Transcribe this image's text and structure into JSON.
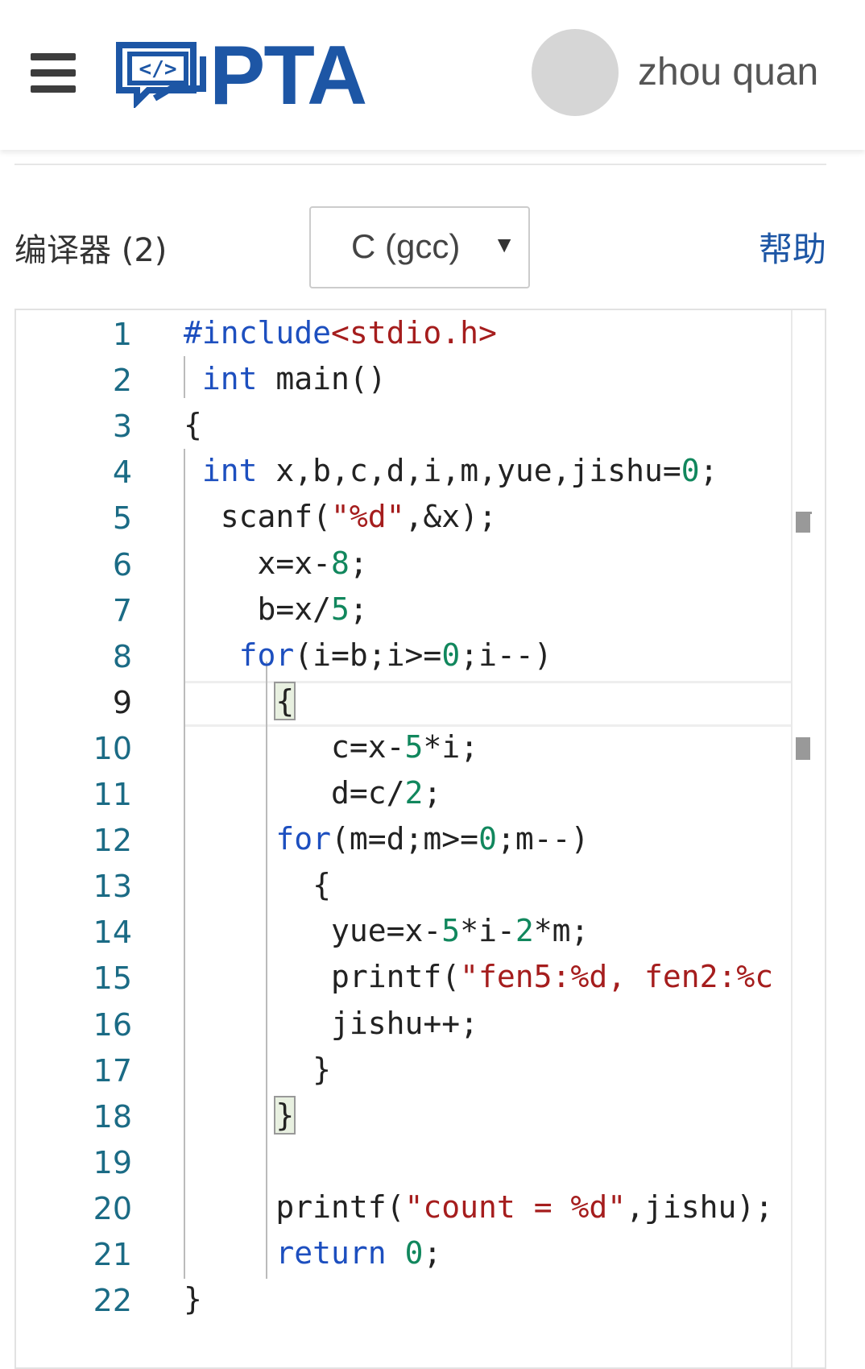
{
  "header": {
    "logo_text": "PTA",
    "username": "zhou quan"
  },
  "toolbar": {
    "compiler_label": "编译器 (2)",
    "compiler_value": "C (gcc)",
    "help_label": "帮助"
  },
  "editor": {
    "language": "C",
    "active_line": 9,
    "lines": [
      {
        "n": "1",
        "tokens": [
          {
            "t": "#include",
            "c": "kw"
          },
          {
            "t": "<stdio.h>",
            "c": "inc"
          }
        ]
      },
      {
        "n": "2",
        "tokens": [
          {
            "t": " ",
            "c": ""
          },
          {
            "t": "int",
            "c": "kw"
          },
          {
            "t": " main()",
            "c": ""
          }
        ]
      },
      {
        "n": "3",
        "tokens": [
          {
            "t": "{",
            "c": ""
          }
        ]
      },
      {
        "n": "4",
        "tokens": [
          {
            "t": " ",
            "c": ""
          },
          {
            "t": "int",
            "c": "kw"
          },
          {
            "t": " x,b,c,d,i,m,yue,jishu=",
            "c": ""
          },
          {
            "t": "0",
            "c": "num"
          },
          {
            "t": ";",
            "c": ""
          }
        ]
      },
      {
        "n": "5",
        "tokens": [
          {
            "t": "  scanf(",
            "c": ""
          },
          {
            "t": "\"%d\"",
            "c": "str"
          },
          {
            "t": ",&x);",
            "c": ""
          }
        ]
      },
      {
        "n": "6",
        "tokens": [
          {
            "t": "    x=x-",
            "c": ""
          },
          {
            "t": "8",
            "c": "num"
          },
          {
            "t": ";",
            "c": ""
          }
        ]
      },
      {
        "n": "7",
        "tokens": [
          {
            "t": "    b=x/",
            "c": ""
          },
          {
            "t": "5",
            "c": "num"
          },
          {
            "t": ";",
            "c": ""
          }
        ]
      },
      {
        "n": "8",
        "tokens": [
          {
            "t": "   ",
            "c": ""
          },
          {
            "t": "for",
            "c": "kw"
          },
          {
            "t": "(i=b;i>=",
            "c": ""
          },
          {
            "t": "0",
            "c": "num"
          },
          {
            "t": ";i--)",
            "c": ""
          }
        ]
      },
      {
        "n": "9",
        "tokens": [
          {
            "t": "     ",
            "c": ""
          },
          {
            "t": "{",
            "c": "bm"
          }
        ]
      },
      {
        "n": "10",
        "tokens": [
          {
            "t": "        c=x-",
            "c": ""
          },
          {
            "t": "5",
            "c": "num"
          },
          {
            "t": "*i;",
            "c": ""
          }
        ]
      },
      {
        "n": "11",
        "tokens": [
          {
            "t": "        d=c/",
            "c": ""
          },
          {
            "t": "2",
            "c": "num"
          },
          {
            "t": ";",
            "c": ""
          }
        ]
      },
      {
        "n": "12",
        "tokens": [
          {
            "t": "     ",
            "c": ""
          },
          {
            "t": "for",
            "c": "kw"
          },
          {
            "t": "(m=d;m>=",
            "c": ""
          },
          {
            "t": "0",
            "c": "num"
          },
          {
            "t": ";m--)",
            "c": ""
          }
        ]
      },
      {
        "n": "13",
        "tokens": [
          {
            "t": "       {",
            "c": ""
          }
        ]
      },
      {
        "n": "14",
        "tokens": [
          {
            "t": "        yue=x-",
            "c": ""
          },
          {
            "t": "5",
            "c": "num"
          },
          {
            "t": "*i-",
            "c": ""
          },
          {
            "t": "2",
            "c": "num"
          },
          {
            "t": "*m;",
            "c": ""
          }
        ]
      },
      {
        "n": "15",
        "tokens": [
          {
            "t": "        printf(",
            "c": ""
          },
          {
            "t": "\"fen5:%d, fen2:%c",
            "c": "str"
          }
        ]
      },
      {
        "n": "16",
        "tokens": [
          {
            "t": "        jishu++;",
            "c": ""
          }
        ]
      },
      {
        "n": "17",
        "tokens": [
          {
            "t": "       }",
            "c": ""
          }
        ]
      },
      {
        "n": "18",
        "tokens": [
          {
            "t": "     ",
            "c": ""
          },
          {
            "t": "}",
            "c": "bm"
          }
        ]
      },
      {
        "n": "19",
        "tokens": []
      },
      {
        "n": "20",
        "tokens": [
          {
            "t": "     printf(",
            "c": ""
          },
          {
            "t": "\"count = %d\"",
            "c": "str"
          },
          {
            "t": ",jishu);",
            "c": ""
          }
        ]
      },
      {
        "n": "21",
        "tokens": [
          {
            "t": "     ",
            "c": ""
          },
          {
            "t": "return",
            "c": "kw"
          },
          {
            "t": " ",
            "c": ""
          },
          {
            "t": "0",
            "c": "num"
          },
          {
            "t": ";",
            "c": ""
          }
        ]
      },
      {
        "n": "22",
        "tokens": [
          {
            "t": "}",
            "c": ""
          }
        ]
      }
    ]
  },
  "colors": {
    "brand": "#1d56a5",
    "keyword": "#1d4fbf",
    "number": "#11875d",
    "string": "#a51d1d",
    "line_number": "#1b6b85"
  },
  "icons": {
    "menu": "hamburger-menu-icon",
    "logo": "code-chat-logo-icon",
    "dropdown": "dropdown-arrow-icon"
  }
}
